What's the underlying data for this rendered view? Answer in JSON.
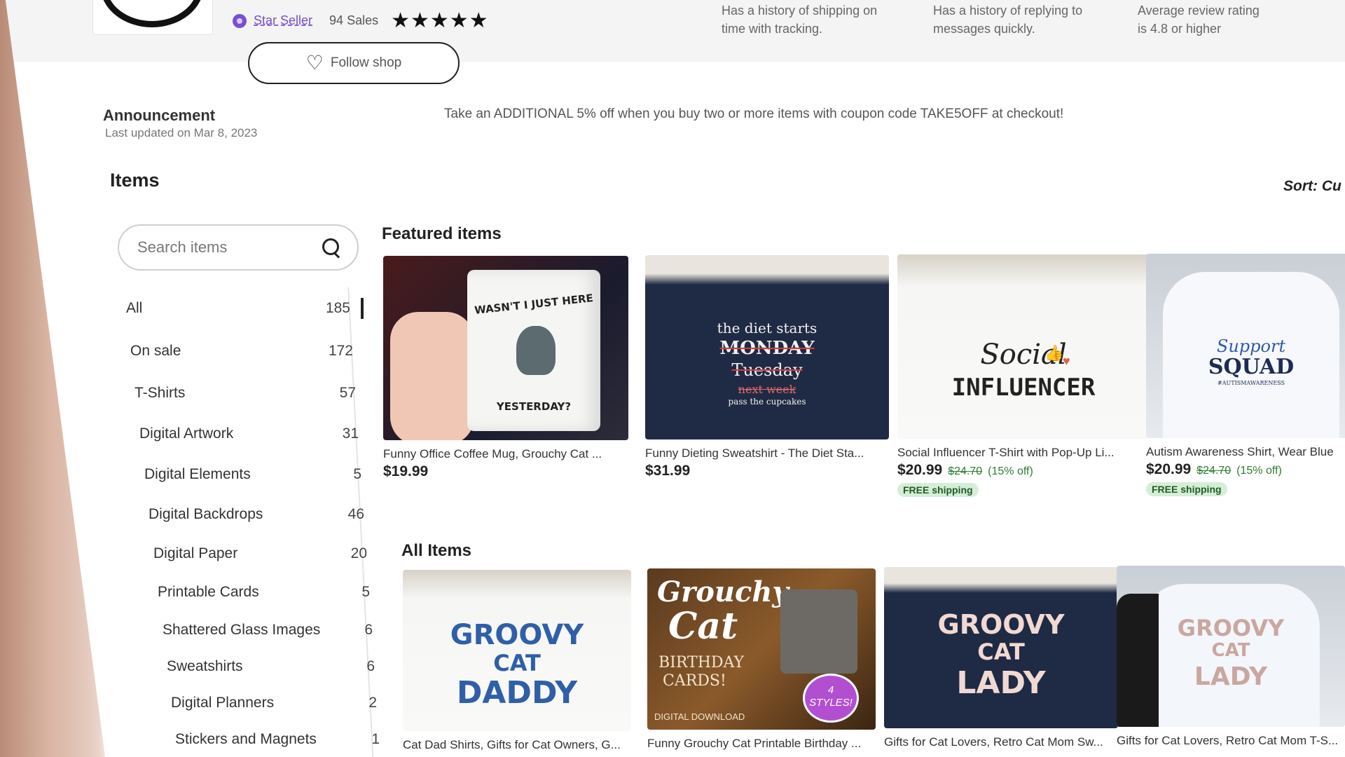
{
  "shop": {
    "star_seller": "Star Seller",
    "sales": "94 Sales",
    "stars": "★★★★★",
    "perks": [
      {
        "line1": "Has a history of shipping on",
        "line2": "time with tracking."
      },
      {
        "line1": "Has a history of replying to",
        "line2": "messages quickly."
      },
      {
        "line1": "Average review rating",
        "line2": "is 4.8 or higher"
      }
    ],
    "follow_label": "Follow shop"
  },
  "announcement": {
    "title": "Announcement",
    "date": "Last updated on Mar 8, 2023",
    "text": "Take an ADDITIONAL 5% off when you buy two or more items with coupon code TAKE5OFF at checkout!"
  },
  "items": {
    "title": "Items",
    "sort": "Sort: Cu",
    "search_placeholder": "Search items"
  },
  "categories": [
    {
      "label": "All",
      "count": "185"
    },
    {
      "label": "On sale",
      "count": "172"
    },
    {
      "label": "T-Shirts",
      "count": "57"
    },
    {
      "label": "Digital Artwork",
      "count": "31"
    },
    {
      "label": "Digital Elements",
      "count": "5"
    },
    {
      "label": "Digital Backdrops",
      "count": "46"
    },
    {
      "label": "Digital Paper",
      "count": "20"
    },
    {
      "label": "Printable Cards",
      "count": "5"
    },
    {
      "label": "Shattered Glass Images",
      "count": "6"
    },
    {
      "label": "Sweatshirts",
      "count": "6"
    },
    {
      "label": "Digital Planners",
      "count": "2"
    },
    {
      "label": "Stickers and Magnets",
      "count": "1"
    }
  ],
  "featured": {
    "title": "Featured items",
    "cards": [
      {
        "title": "Funny Office Coffee Mug, Grouchy Cat ...",
        "price": "$19.99",
        "art": [
          "WASN'T I JUST HERE",
          "YESTERDAY?"
        ]
      },
      {
        "title": "Funny Dieting Sweatshirt - The Diet Sta...",
        "price": "$31.99",
        "art": [
          "the diet starts",
          "MONDAY",
          "Tuesday",
          "next week",
          "pass the cupcakes"
        ]
      },
      {
        "title": "Social Influencer T-Shirt with Pop-Up Li...",
        "price": "$20.99",
        "old": "$24.70",
        "off": "(15% off)",
        "ship": "FREE shipping",
        "art": [
          "Social",
          "INFLUENCER"
        ]
      },
      {
        "title": "Autism Awareness Shirt, Wear Blue",
        "price": "$20.99",
        "old": "$24.70",
        "off": "(15% off)",
        "ship": "FREE shipping",
        "art": [
          "Support",
          "SQUAD",
          "#AUTISMAWARENESS"
        ]
      }
    ]
  },
  "all_items": {
    "title": "All Items",
    "cards": [
      {
        "title": "Cat Dad Shirts, Gifts for Cat Owners, G...",
        "art": [
          "GROOVY",
          "CAT",
          "DADDY"
        ]
      },
      {
        "title": "Funny Grouchy Cat Printable Birthday ...",
        "art": [
          "Grouchy",
          "Cat",
          "BIRTHDAY",
          "CARDS!",
          "DIGITAL DOWNLOAD",
          "4",
          "STYLES!"
        ]
      },
      {
        "title": "Gifts for Cat Lovers, Retro Cat Mom Sw...",
        "art": [
          "GROOVY",
          "CAT",
          "LADY"
        ]
      },
      {
        "title": "Gifts for Cat Lovers, Retro Cat Mom T-S...",
        "art": [
          "GROOVY",
          "CAT",
          "LADY"
        ]
      }
    ]
  },
  "colors": {
    "star_seller": "#7a4fd1",
    "sale_green": "#2f7d32",
    "ship_badge": "#d5eed8"
  }
}
